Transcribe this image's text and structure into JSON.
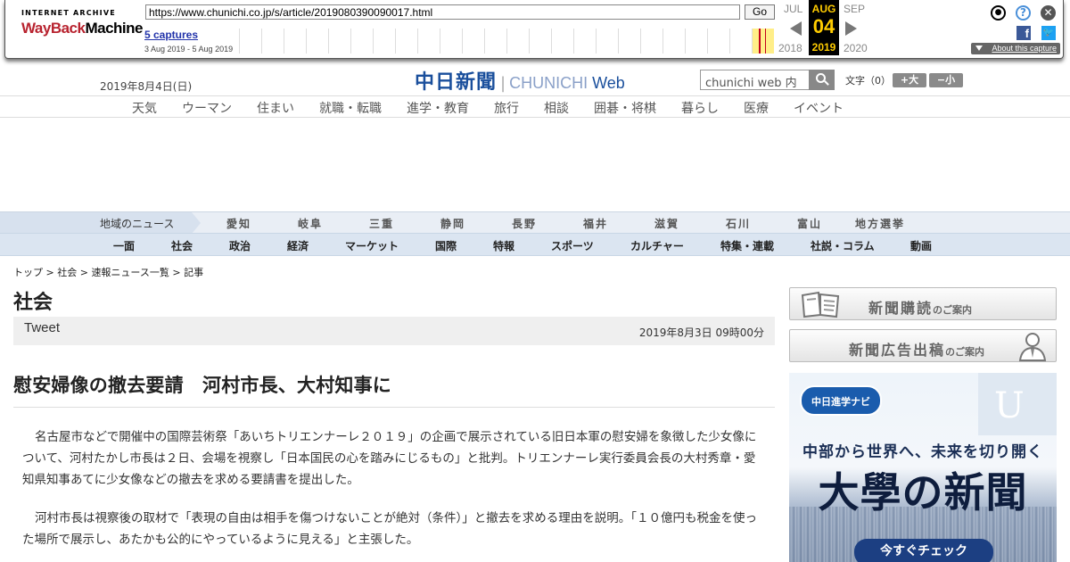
{
  "wayback": {
    "logo_line1": "INTERNET ARCHIVE",
    "logo_line2a": "WayBack",
    "logo_line2b": "Machine",
    "url": "https://www.chunichi.co.jp/s/article/2019080390090017.html",
    "go_label": "Go",
    "captures": "5 captures",
    "range": "3 Aug 2019 - 5 Aug 2019",
    "prev_month": "JUL",
    "cur_month": "AUG",
    "next_month": "SEP",
    "cur_day": "04",
    "prev_year": "2018",
    "cur_year": "2019",
    "next_year": "2020",
    "about": "About this capture",
    "colors": {
      "highlight": "#ffee88",
      "marker": "#c3001e",
      "current_bg": "#000000",
      "current_fg": "#ffcc00"
    },
    "icons": [
      "user-icon",
      "help-icon",
      "close-icon",
      "facebook-icon",
      "twitter-icon"
    ]
  },
  "header": {
    "date": "2019年8月4日(日)",
    "logo_kanji": "中日新聞",
    "logo_en": "CHUNICHI",
    "logo_web": "Web",
    "search_placeholder": "chunichi web 内",
    "font_size_label": "文字（0）",
    "font_up": "+大",
    "font_down": "−小"
  },
  "main_nav": [
    "天気",
    "ウーマン",
    "住まい",
    "就職・転職",
    "進学・教育",
    "旅行",
    "相談",
    "囲碁・将棋",
    "暮らし",
    "医療",
    "イベント"
  ],
  "region_nav": {
    "label": "地域のニュース",
    "items": [
      "愛知",
      "岐阜",
      "三重",
      "静岡",
      "長野",
      "福井",
      "滋賀",
      "石川",
      "富山",
      "地方選挙"
    ]
  },
  "category_nav": [
    "一面",
    "社会",
    "政治",
    "経済",
    "マーケット",
    "国際",
    "特報",
    "スポーツ",
    "カルチャー",
    "特集・連載",
    "社説・コラム",
    "動画"
  ],
  "breadcrumb": [
    "トップ",
    "社会",
    "速報ニュース一覧",
    "記事"
  ],
  "breadcrumb_sep": " > ",
  "article": {
    "section": "社会",
    "tweet": "Tweet",
    "published": "2019年8月3日 09時00分",
    "headline": "慰安婦像の撤去要請　河村市長、大村知事に",
    "paragraphs": [
      "名古屋市などで開催中の国際芸術祭「あいちトリエンナーレ２０１９」の企画で展示されている旧日本軍の慰安婦を象徴した少女像について、河村たかし市長は２日、会場を視察し「日本国民の心を踏みにじるもの」と批判。トリエンナーレ実行委員会長の大村秀章・愛知県知事あてに少女像などの撤去を求める要請書を提出した。",
      "河村市長は視察後の取材で「表現の自由は相手を傷つけないことが絶対（条件）」と撤去を求める理由を説明。「１０億円も税金を使った場所で展示し、あたかも公的にやっているように見える」と主張した。"
    ]
  },
  "sidebar": {
    "btn1_main": "新聞購読",
    "btn1_sub": "のご案内",
    "btn2_main": "新聞広告出稿",
    "btn2_sub": "のご案内",
    "ad": {
      "badge": "中日進学ナビ",
      "tagline": "中部から世界へ、未来を切り開く",
      "title": "大學の新聞",
      "cta": "今すぐチェック"
    }
  },
  "colors": {
    "brand": "#1a4f9c",
    "region_bg": "#e9eef5",
    "category_bg": "#dbe5f1"
  }
}
